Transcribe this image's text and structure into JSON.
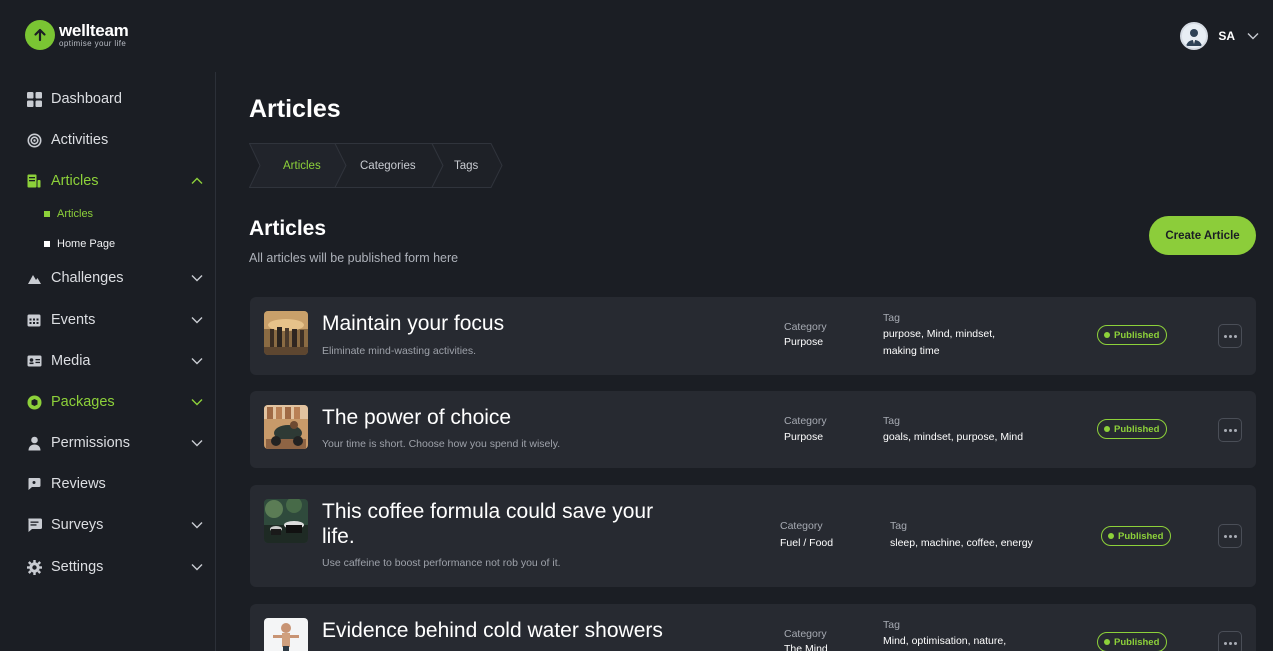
{
  "brand": {
    "name": "wellteam",
    "tagline": "optimise your life"
  },
  "user": {
    "initials": "SA"
  },
  "sidebar": {
    "items": [
      {
        "label": "Dashboard",
        "icon": "grid-icon"
      },
      {
        "label": "Activities",
        "icon": "target-icon"
      },
      {
        "label": "Articles",
        "icon": "document-icon"
      },
      {
        "label": "Challenges",
        "icon": "mountain-icon"
      },
      {
        "label": "Events",
        "icon": "calendar-icon"
      },
      {
        "label": "Media",
        "icon": "id-card-icon"
      },
      {
        "label": "Packages",
        "icon": "package-icon"
      },
      {
        "label": "Permissions",
        "icon": "user-icon"
      },
      {
        "label": "Reviews",
        "icon": "chat-icon"
      },
      {
        "label": "Surveys",
        "icon": "survey-icon"
      },
      {
        "label": "Settings",
        "icon": "gear-icon"
      }
    ],
    "subitems": [
      {
        "label": "Articles"
      },
      {
        "label": "Home Page"
      }
    ]
  },
  "page": {
    "title": "Articles",
    "breadcrumb": [
      "Articles",
      "Categories",
      "Tags"
    ],
    "section_title": "Articles",
    "section_subtitle": "All articles will be published form here",
    "create_button": "Create Article"
  },
  "table": {
    "category_label": "Category",
    "tag_label": "Tag",
    "status_label": "Published",
    "rows": [
      {
        "title": "Maintain your focus",
        "subtitle": "Eliminate mind-wasting activities.",
        "category": "Purpose",
        "tags_line1": "purpose, Mind, mindset,",
        "tags_line2": "making time",
        "status": "Published"
      },
      {
        "title": "The power of choice",
        "subtitle": "Your time is short. Choose how you spend it wisely.",
        "category": "Purpose",
        "tags_line1": "goals, mindset, purpose, Mind",
        "tags_line2": "",
        "status": "Published"
      },
      {
        "title_line1": "This coffee formula could save your",
        "title_line2": "life.",
        "subtitle": "Use caffeine to boost performance not rob you of it.",
        "category": "Fuel / Food",
        "tags_line1": "sleep, machine, coffee, energy",
        "tags_line2": "",
        "status": "Published"
      },
      {
        "title": "Evidence behind cold water showers",
        "subtitle": "",
        "category": "The Mind",
        "tags_line1": "Mind, optimisation, nature,",
        "tags_line2": "",
        "status": "Published"
      }
    ]
  },
  "colors": {
    "accent": "#8dd13a",
    "background": "#1b1e24",
    "card": "#272a31"
  }
}
